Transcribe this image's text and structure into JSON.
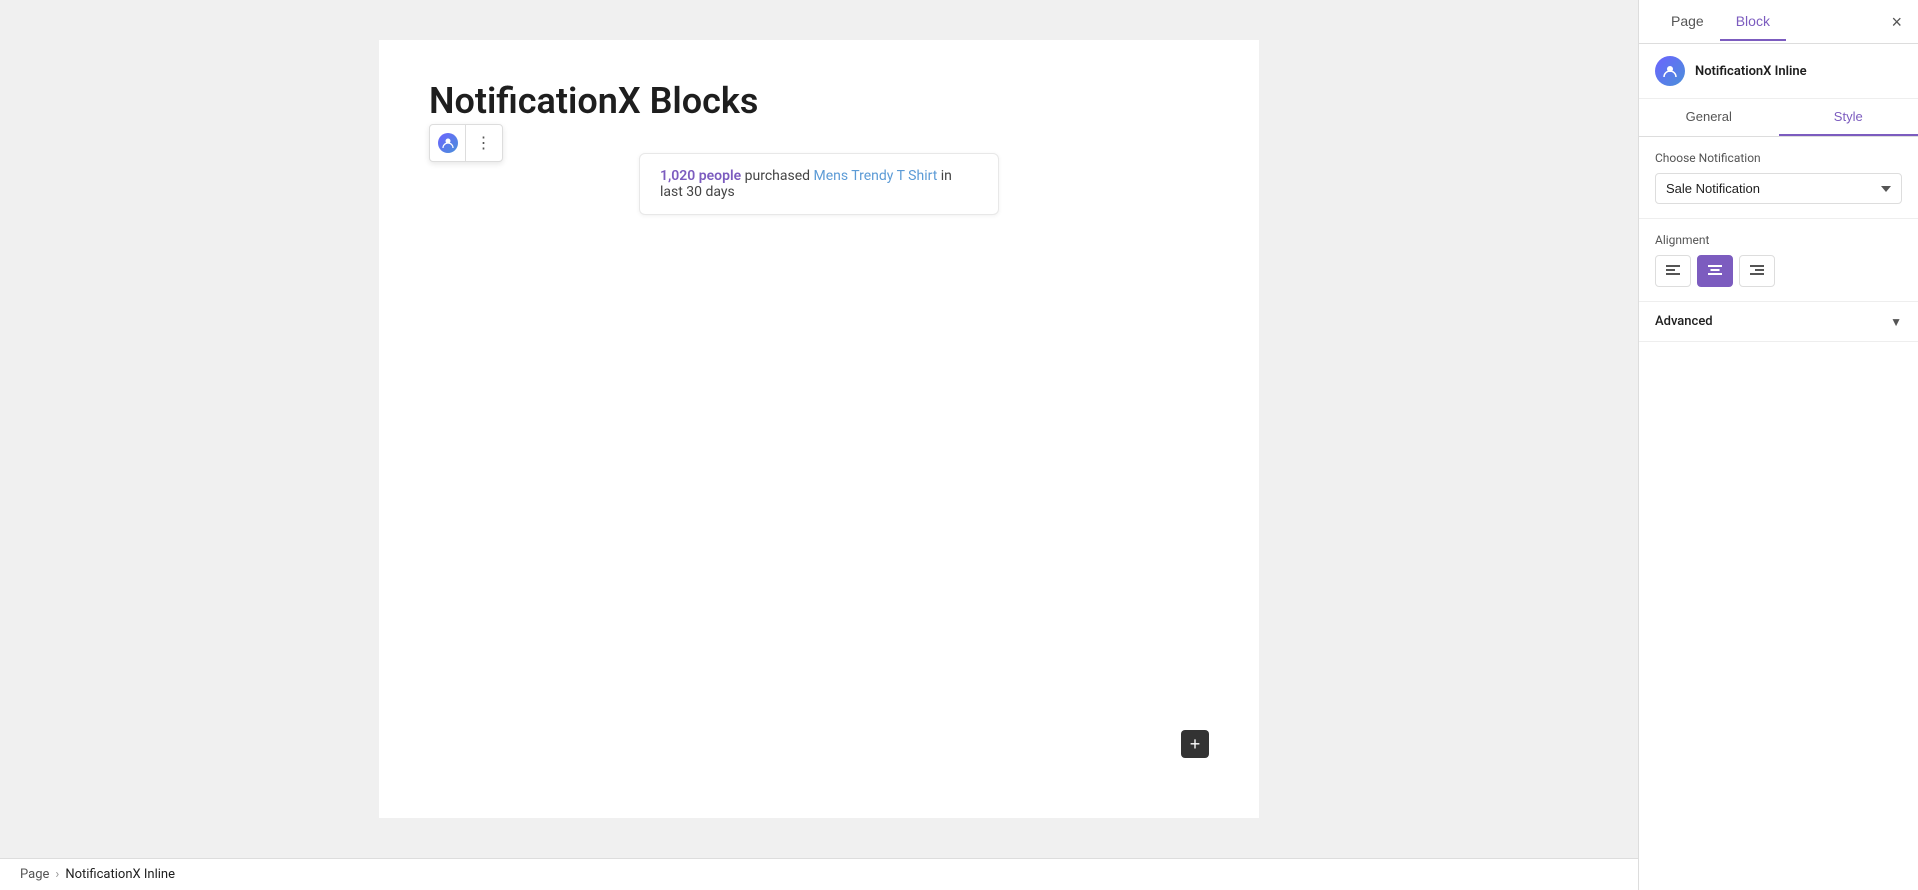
{
  "sidebar": {
    "page_tab": "Page",
    "block_tab": "Block",
    "close_btn": "×",
    "block_label": "NotificationX Inline",
    "inner_tabs": {
      "general": "General",
      "style": "Style"
    },
    "choose_notification_label": "Choose Notification",
    "notification_value": "Sale Notification",
    "alignment_label": "Alignment",
    "alignment_options": [
      "left",
      "center",
      "right"
    ],
    "advanced_label": "Advanced"
  },
  "editor": {
    "title": "NotificationX Blocks",
    "notification": {
      "count": "1,020",
      "people": "people",
      "purchased": "purchased",
      "product": "Mens Trendy T Shirt",
      "tail": "in last 30 days"
    },
    "add_block_label": "+"
  },
  "breadcrumb": {
    "page": "Page",
    "separator": "›",
    "current": "NotificationX Inline"
  },
  "colors": {
    "accent": "#7c5cbf",
    "link_blue": "#5c9bd6",
    "active_bg": "#7c5cbf"
  }
}
